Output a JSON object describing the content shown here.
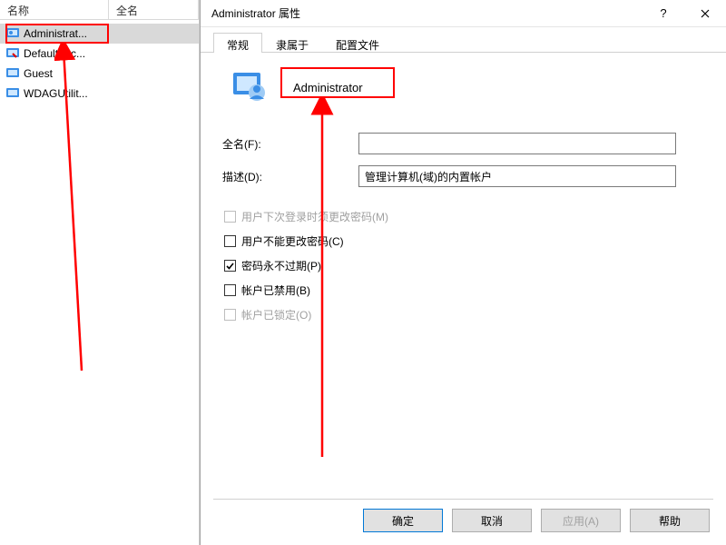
{
  "left_pane": {
    "header_name": "名称",
    "header_fullname": "全名",
    "items": [
      {
        "label": "Administrat...",
        "selected": true
      },
      {
        "label": "DefaultAcc..."
      },
      {
        "label": "Guest"
      },
      {
        "label": "WDAGUtilit..."
      }
    ]
  },
  "dialog": {
    "title": "Administrator 属性",
    "help_glyph": "?",
    "tabs": [
      {
        "label": "常规",
        "active": true
      },
      {
        "label": "隶属于"
      },
      {
        "label": "配置文件"
      }
    ],
    "account_name": "Administrator",
    "fields": {
      "fullname_label": "全名(F):",
      "fullname_value": "",
      "desc_label": "描述(D):",
      "desc_value": "管理计算机(域)的内置帐户"
    },
    "checkboxes": [
      {
        "label": "用户下次登录时须更改密码(M)",
        "checked": false,
        "disabled": true
      },
      {
        "label": "用户不能更改密码(C)",
        "checked": false,
        "disabled": false
      },
      {
        "label": "密码永不过期(P)",
        "checked": true,
        "disabled": false
      },
      {
        "label": "帐户已禁用(B)",
        "checked": false,
        "disabled": false
      },
      {
        "label": "帐户已锁定(O)",
        "checked": false,
        "disabled": true
      }
    ],
    "buttons": {
      "ok": "确定",
      "cancel": "取消",
      "apply": "应用(A)",
      "help": "帮助"
    }
  }
}
